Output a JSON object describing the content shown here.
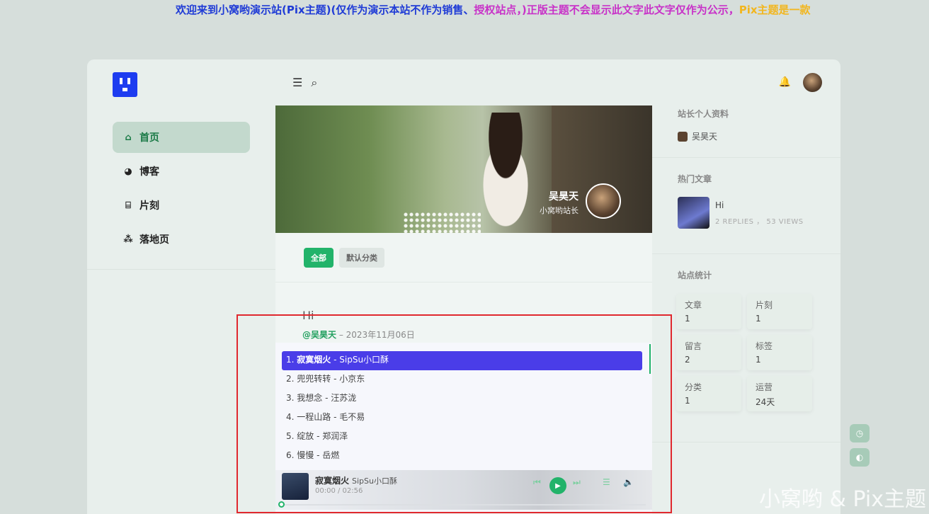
{
  "banner": {
    "text_parts": [
      {
        "text": "欢迎来到小窝哟演示站(Pix主题)(仅作为演示本站不作为销售、",
        "color": "#1f3bd6"
      },
      {
        "text": "授权站点，)正版主题不会显示此文字此文字仅作为公示，",
        "color": "#c832c8"
      },
      {
        "text": "Pix主题是一款",
        "color": "#f2b61e"
      }
    ]
  },
  "sidebar": {
    "items": [
      {
        "label": "首页",
        "icon": "home-icon",
        "active": true
      },
      {
        "label": "博客",
        "icon": "blog-icon",
        "active": false
      },
      {
        "label": "片刻",
        "icon": "moment-icon",
        "active": false
      },
      {
        "label": "落地页",
        "icon": "landing-icon",
        "active": false
      }
    ]
  },
  "header": {
    "menu_icon": "menu-icon",
    "search_icon": "search-icon"
  },
  "hero": {
    "name": "吴昊天",
    "subtitle": "小窝哟站长"
  },
  "filters": [
    "全部",
    "默认分类"
  ],
  "post": {
    "title": "Hi",
    "author": "@吴昊天",
    "date": "2023年11月06日"
  },
  "player": {
    "playlist": [
      {
        "index": "1.",
        "title": "寂寞烟火",
        "artist": "SipSu小口酥"
      },
      {
        "index": "2.",
        "title": "兜兜转转",
        "artist": "小京东"
      },
      {
        "index": "3.",
        "title": "我想念",
        "artist": "汪苏泷"
      },
      {
        "index": "4.",
        "title": "一程山路",
        "artist": "毛不易"
      },
      {
        "index": "5.",
        "title": "绽放",
        "artist": "郑润泽"
      },
      {
        "index": "6.",
        "title": "慢慢",
        "artist": "岳燃"
      }
    ],
    "now_playing": {
      "title": "寂寞烟火",
      "artist": "SipSu小口酥",
      "time": "00:00 / 02:56"
    },
    "progress_fraction": 0
  },
  "right": {
    "owner_section": "站长个人资料",
    "owner_name": "吴昊天",
    "hot_section": "热门文章",
    "hot_post": {
      "title": "Hi",
      "meta": "2 REPLIES ， 53 VIEWS"
    },
    "stats_section": "站点统计",
    "stats": [
      {
        "label": "文章",
        "value": "1"
      },
      {
        "label": "片刻",
        "value": "1"
      },
      {
        "label": "留言",
        "value": "2"
      },
      {
        "label": "标签",
        "value": "1"
      },
      {
        "label": "分类",
        "value": "1"
      },
      {
        "label": "运营",
        "value": "24天"
      }
    ]
  },
  "watermark": "小窝哟 & Pix主题",
  "colors": {
    "accent": "#22b36a",
    "playlist_active": "#4a3de8",
    "highlight_box": "#e0282e"
  }
}
